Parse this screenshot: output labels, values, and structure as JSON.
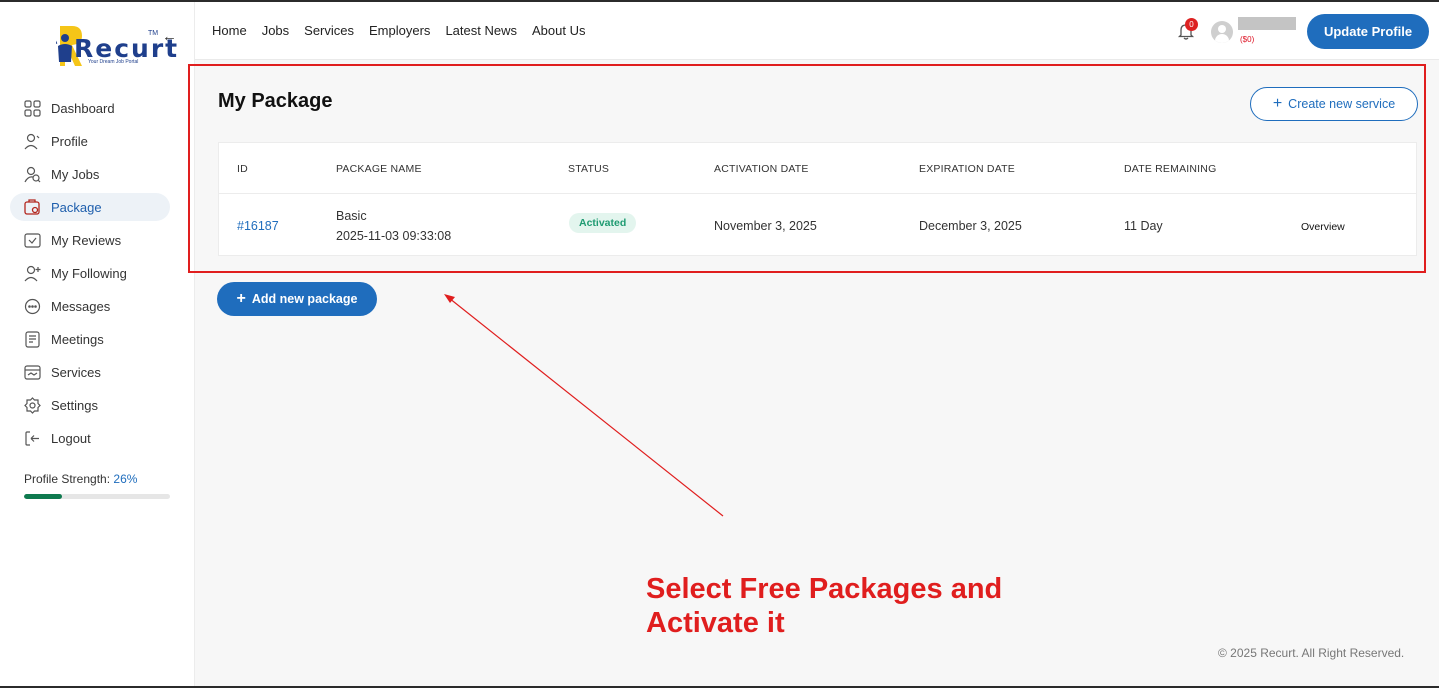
{
  "sidebar": {
    "logo": {
      "text": "Recurt",
      "tm": "TM",
      "tagline": "Your Dream Job Portal"
    },
    "items": [
      {
        "label": "Dashboard",
        "icon": "dashboard-icon"
      },
      {
        "label": "Profile",
        "icon": "profile-icon"
      },
      {
        "label": "My Jobs",
        "icon": "jobs-icon"
      },
      {
        "label": "Package",
        "icon": "package-icon",
        "active": true
      },
      {
        "label": "My Reviews",
        "icon": "reviews-icon"
      },
      {
        "label": "My Following",
        "icon": "following-icon"
      },
      {
        "label": "Messages",
        "icon": "messages-icon"
      },
      {
        "label": "Meetings",
        "icon": "meetings-icon"
      },
      {
        "label": "Services",
        "icon": "services-icon"
      },
      {
        "label": "Settings",
        "icon": "settings-icon"
      },
      {
        "label": "Logout",
        "icon": "logout-icon"
      }
    ],
    "profile_strength": {
      "label": "Profile Strength:",
      "value": "26%",
      "fraction": 0.26,
      "color": "#0f7a4f"
    }
  },
  "header": {
    "nav": [
      "Home",
      "Jobs",
      "Services",
      "Employers",
      "Latest News",
      "About Us"
    ],
    "notifications_count": "0",
    "balance": "($0)",
    "update_profile_label": "Update Profile"
  },
  "main": {
    "title": "My Package",
    "create_button_label": "Create new service",
    "table": {
      "headers": [
        "ID",
        "PACKAGE NAME",
        "STATUS",
        "ACTIVATION DATE",
        "EXPIRATION DATE",
        "DATE REMAINING"
      ],
      "rows": [
        {
          "id": "#16187",
          "package_name": "Basic",
          "package_datetime": "2025-11-03 09:33:08",
          "status": "Activated",
          "activation_date": "November 3, 2025",
          "expiration_date": "December 3, 2025",
          "date_remaining": "11 Day",
          "action": "Overview"
        }
      ]
    },
    "add_button_label": "Add new package"
  },
  "annotation": {
    "text_line1": "Select Free Packages and",
    "text_line2": "Activate it",
    "color": "#e01e1e"
  },
  "footer": {
    "copyright": "© 2025 Recurt. All Right Reserved."
  },
  "colors": {
    "primary": "#1f6dbd",
    "success_bg": "#e3f5ee",
    "success_text": "#1f9b72",
    "highlight": "#e01e1e"
  }
}
